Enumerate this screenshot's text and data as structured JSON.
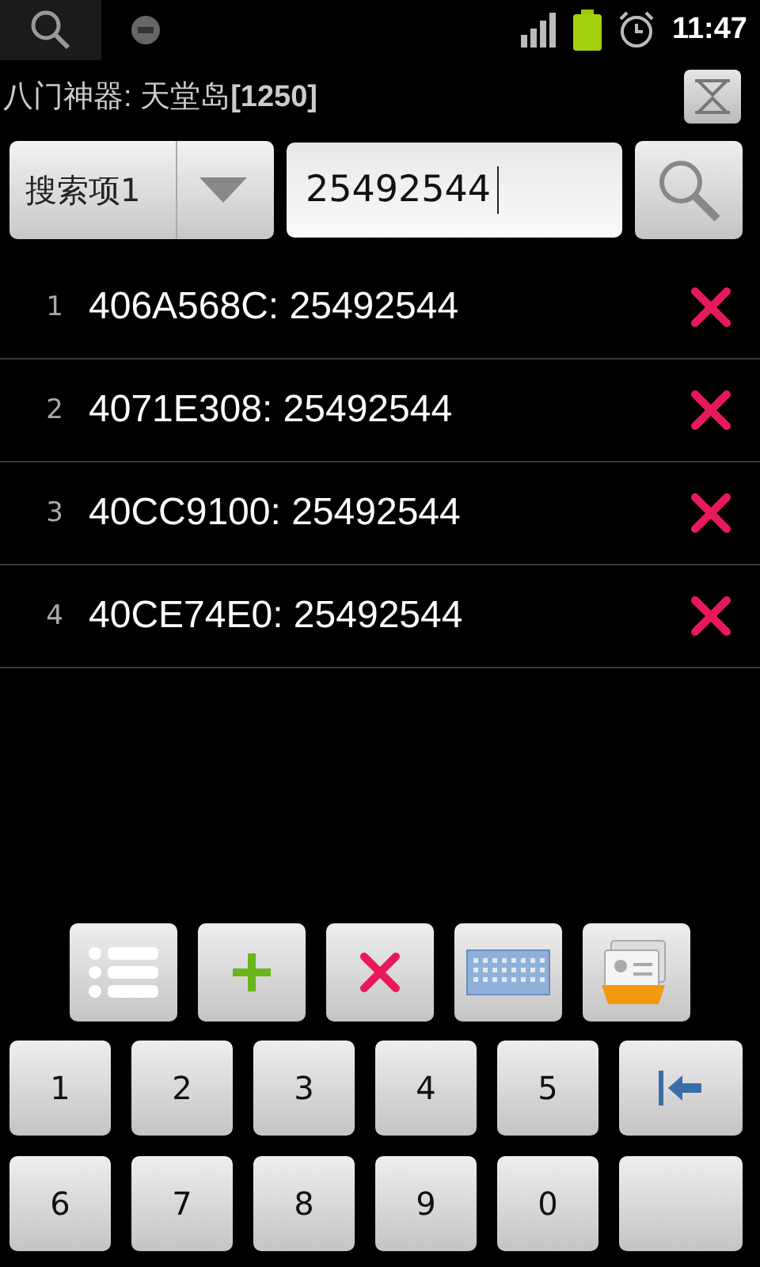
{
  "status_bar": {
    "time": "11:47"
  },
  "title": "八门神器: 天堂岛**[1250]**",
  "search": {
    "dropdown": "搜索项1",
    "value": "25492544"
  },
  "results": [
    {
      "index": "1",
      "text": "406A568C: 25492544"
    },
    {
      "index": "2",
      "text": "4071E308: 25492544"
    },
    {
      "index": "3",
      "text": "40CC9100: 25492544"
    },
    {
      "index": "4",
      "text": "40CE74E0: 25492544"
    }
  ],
  "toolbar": [
    {
      "kind": "list"
    },
    {
      "kind": "add"
    },
    {
      "kind": "delete"
    },
    {
      "kind": "keyboard"
    },
    {
      "kind": "folder"
    }
  ],
  "keypad": [
    {
      "kind": "digit",
      "label": "1"
    },
    {
      "kind": "digit",
      "label": "2"
    },
    {
      "kind": "digit",
      "label": "3"
    },
    {
      "kind": "digit",
      "label": "4"
    },
    {
      "kind": "digit",
      "label": "5"
    },
    {
      "kind": "backspace"
    },
    {
      "kind": "digit",
      "label": "6"
    },
    {
      "kind": "digit",
      "label": "7"
    },
    {
      "kind": "digit",
      "label": "8"
    },
    {
      "kind": "digit",
      "label": "9"
    },
    {
      "kind": "digit",
      "label": "0"
    },
    {
      "kind": "blank"
    }
  ]
}
